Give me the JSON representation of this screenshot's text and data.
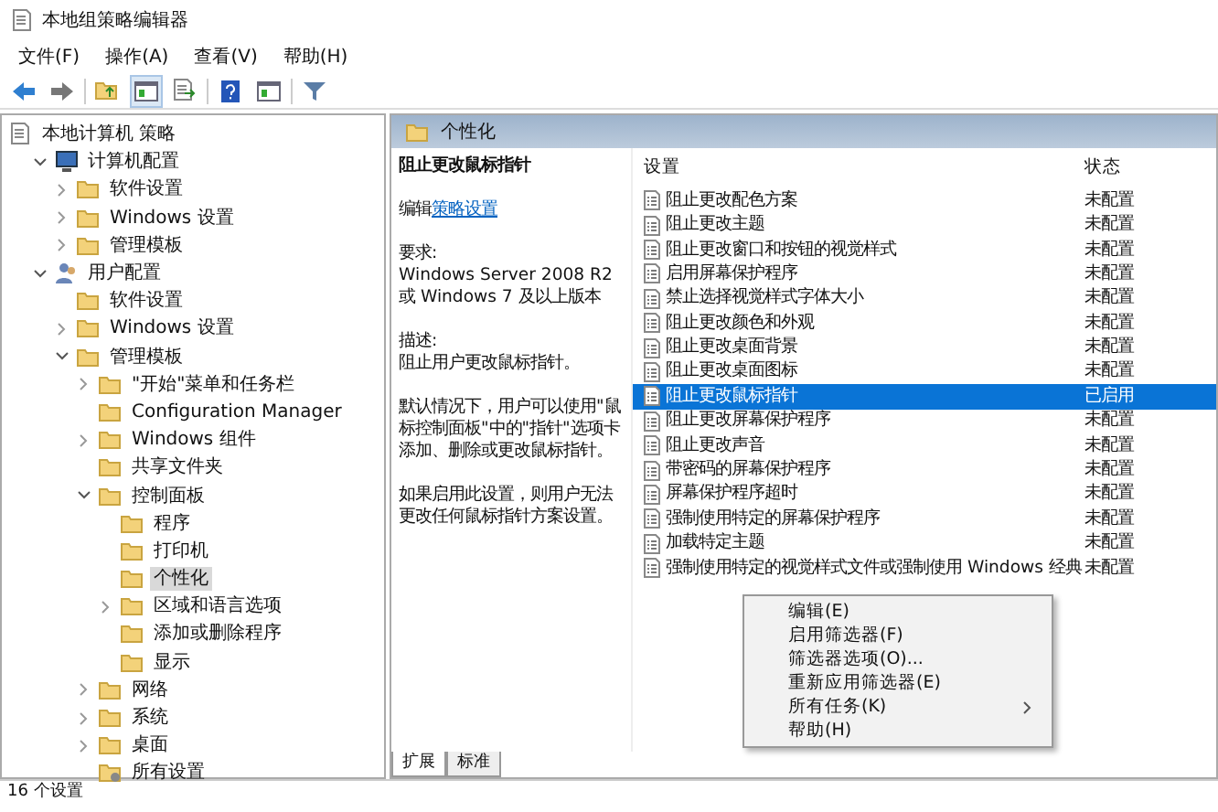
{
  "window": {
    "title": "本地组策略编辑器"
  },
  "menu": [
    "文件(F)",
    "操作(A)",
    "查看(V)",
    "帮助(H)"
  ],
  "toolbar": [
    {
      "kind": "back"
    },
    {
      "kind": "forward"
    },
    {
      "kind": "sep"
    },
    {
      "kind": "up"
    },
    {
      "kind": "pane",
      "selected": true
    },
    {
      "kind": "export"
    },
    {
      "kind": "sep"
    },
    {
      "kind": "help"
    },
    {
      "kind": "pane",
      "selected": false
    },
    {
      "kind": "sep"
    },
    {
      "kind": "filter"
    }
  ],
  "tree": [
    {
      "label": "本地计算机 策略",
      "kind": "policy",
      "selected": false,
      "children": [
        {
          "label": "计算机配置",
          "kind": "computer",
          "expanded": true,
          "selected": false,
          "children": [
            {
              "label": "软件设置",
              "kind": "folder",
              "expanded": false,
              "selected": false
            },
            {
              "label": "Windows 设置",
              "kind": "folder",
              "expanded": false,
              "selected": false
            },
            {
              "label": "管理模板",
              "kind": "folder",
              "expanded": false,
              "selected": false
            }
          ]
        },
        {
          "label": "用户配置",
          "kind": "user",
          "expanded": true,
          "selected": false,
          "children": [
            {
              "label": "软件设置",
              "kind": "folder",
              "selected": false
            },
            {
              "label": "Windows 设置",
              "kind": "folder",
              "expanded": false,
              "selected": false
            },
            {
              "label": "管理模板",
              "kind": "folder",
              "expanded": true,
              "selected": false,
              "children": [
                {
                  "label": "\"开始\"菜单和任务栏",
                  "kind": "folder",
                  "expanded": false,
                  "selected": false
                },
                {
                  "label": "Configuration Manager",
                  "kind": "folder",
                  "selected": false
                },
                {
                  "label": "Windows 组件",
                  "kind": "folder",
                  "expanded": false,
                  "selected": false
                },
                {
                  "label": "共享文件夹",
                  "kind": "folder",
                  "selected": false
                },
                {
                  "label": "控制面板",
                  "kind": "folder",
                  "expanded": true,
                  "selected": false,
                  "children": [
                    {
                      "label": "程序",
                      "kind": "folder",
                      "selected": false
                    },
                    {
                      "label": "打印机",
                      "kind": "folder",
                      "selected": false
                    },
                    {
                      "label": "个性化",
                      "kind": "folder",
                      "selected": true
                    },
                    {
                      "label": "区域和语言选项",
                      "kind": "folder",
                      "expanded": false,
                      "selected": false
                    },
                    {
                      "label": "添加或删除程序",
                      "kind": "folder",
                      "selected": false
                    },
                    {
                      "label": "显示",
                      "kind": "folder",
                      "selected": false
                    }
                  ]
                },
                {
                  "label": "网络",
                  "kind": "folder",
                  "expanded": false,
                  "selected": false
                },
                {
                  "label": "系统",
                  "kind": "folder",
                  "expanded": false,
                  "selected": false
                },
                {
                  "label": "桌面",
                  "kind": "folder",
                  "expanded": false,
                  "selected": false
                },
                {
                  "label": "所有设置",
                  "kind": "settings",
                  "selected": false
                }
              ]
            }
          ]
        }
      ]
    }
  ],
  "header": {
    "title": "个性化"
  },
  "description": {
    "title": "阻止更改鼠标指针",
    "edit_prefix": "编辑",
    "edit_link": "策略设置",
    "requirements_label": "要求:",
    "requirements": "Windows Server 2008 R2 或 Windows 7 及以上版本",
    "description_label": "描述:",
    "paragraphs": [
      "阻止用户更改鼠标指针。",
      "默认情况下，用户可以使用\"鼠标控制面板\"中的\"指针\"选项卡添加、删除或更改鼠标指针。",
      "如果启用此设置，则用户无法更改任何鼠标指针方案设置。"
    ]
  },
  "table": {
    "columns": [
      "设置",
      "状态"
    ],
    "rows": [
      {
        "name": "阻止更改配色方案",
        "status": "未配置",
        "selected": false
      },
      {
        "name": "阻止更改主题",
        "status": "未配置",
        "selected": false
      },
      {
        "name": "阻止更改窗口和按钮的视觉样式",
        "status": "未配置",
        "selected": false
      },
      {
        "name": "启用屏幕保护程序",
        "status": "未配置",
        "selected": false
      },
      {
        "name": "禁止选择视觉样式字体大小",
        "status": "未配置",
        "selected": false
      },
      {
        "name": "阻止更改颜色和外观",
        "status": "未配置",
        "selected": false
      },
      {
        "name": "阻止更改桌面背景",
        "status": "未配置",
        "selected": false
      },
      {
        "name": "阻止更改桌面图标",
        "status": "未配置",
        "selected": false
      },
      {
        "name": "阻止更改鼠标指针",
        "status": "已启用",
        "selected": true
      },
      {
        "name": "阻止更改屏幕保护程序",
        "status": "未配置",
        "selected": false
      },
      {
        "name": "阻止更改声音",
        "status": "未配置",
        "selected": false
      },
      {
        "name": "带密码的屏幕保护程序",
        "status": "未配置",
        "selected": false
      },
      {
        "name": "屏幕保护程序超时",
        "status": "未配置",
        "selected": false
      },
      {
        "name": "强制使用特定的屏幕保护程序",
        "status": "未配置",
        "selected": false
      },
      {
        "name": "加载特定主题",
        "status": "未配置",
        "selected": false
      },
      {
        "name": "强制使用特定的视觉样式文件或强制使用 Windows 经典",
        "status": "未配置",
        "selected": false
      }
    ]
  },
  "context_menu": [
    {
      "label": "编辑(E)",
      "submenu": false
    },
    {
      "label": "启用筛选器(F)",
      "submenu": false
    },
    {
      "label": "筛选器选项(O)...",
      "submenu": false
    },
    {
      "label": "重新应用筛选器(E)",
      "submenu": false
    },
    {
      "label": "所有任务(K)",
      "submenu": true
    },
    {
      "label": "帮助(H)",
      "submenu": false
    }
  ],
  "bottom_tabs": [
    {
      "label": "扩展",
      "selected": true
    },
    {
      "label": "标准",
      "selected": false
    }
  ],
  "status_bar": "16 个设置"
}
